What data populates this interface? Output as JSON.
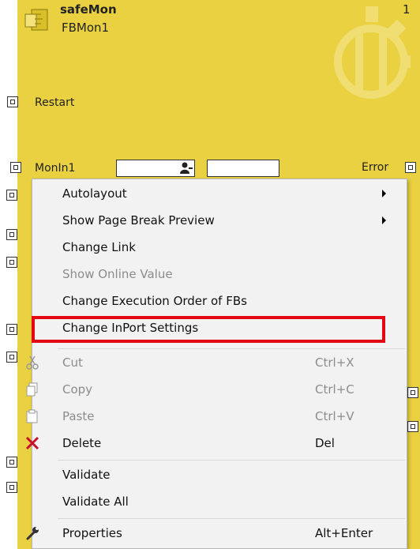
{
  "function_block": {
    "type": "safeMon",
    "name": "FBMon1",
    "execution_order": "1",
    "ports": {
      "restart": "Restart",
      "monin1": "MonIn1",
      "error": "Error"
    }
  },
  "context_menu": {
    "items": [
      {
        "label": "Autolayout",
        "submenu": true
      },
      {
        "label": "Show Page Break Preview",
        "submenu": true
      },
      {
        "label": "Change Link"
      },
      {
        "label": "Show Online Value",
        "disabled": true
      },
      {
        "label": "Change Execution Order of FBs"
      },
      {
        "label": "Change InPort Settings",
        "highlighted": true
      },
      {
        "label": "Cut",
        "shortcut": "Ctrl+X",
        "disabled": true,
        "icon": "scissors-icon"
      },
      {
        "label": "Copy",
        "shortcut": "Ctrl+C",
        "disabled": true,
        "icon": "copy-icon"
      },
      {
        "label": "Paste",
        "shortcut": "Ctrl+V",
        "disabled": true,
        "icon": "paste-icon"
      },
      {
        "label": "Delete",
        "shortcut": "Del",
        "icon": "delete-x-icon"
      },
      {
        "label": "Validate"
      },
      {
        "label": "Validate All"
      },
      {
        "label": "Properties",
        "shortcut": "Alt+Enter",
        "icon": "wrench-icon"
      }
    ]
  },
  "colors": {
    "block_fill": "#e9d142",
    "menu_bg": "#f2f2f2",
    "highlight_border": "#e30613",
    "delete_icon": "#c8102e"
  }
}
